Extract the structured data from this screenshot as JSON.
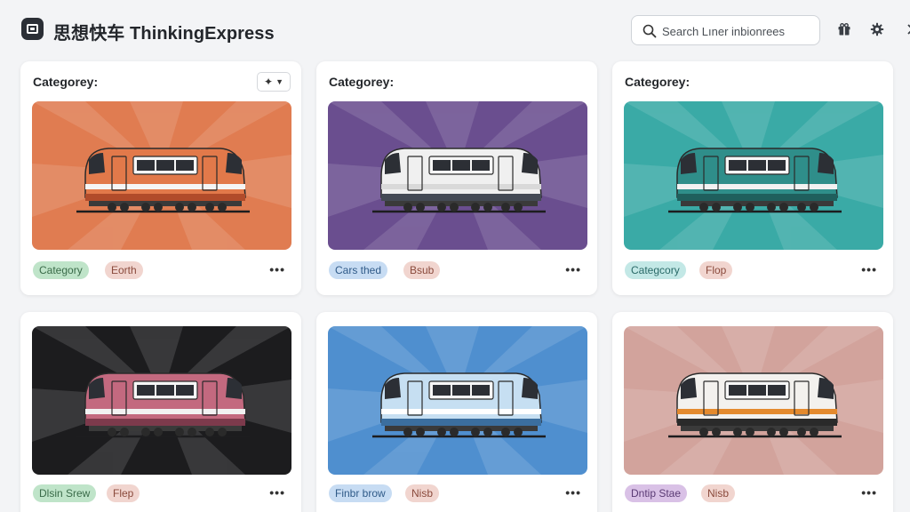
{
  "app": {
    "title": "思想快车 ThinkingExpress"
  },
  "search": {
    "placeholder": "Search Lıner inbionrees"
  },
  "header_icons": [
    "gift-icon",
    "gear-icon"
  ],
  "cards": [
    {
      "title": "Categorey:",
      "has_menu": true,
      "menu_icon": "sparkle-icon",
      "bg": "#e07c51",
      "body": "#e2794a",
      "stripe": "#f5f5f5",
      "accent": "#b14b2a",
      "tags": [
        {
          "label": "Category",
          "bg": "#bfe4c9",
          "color": "#3a6b49"
        },
        {
          "label": "Eorth",
          "bg": "#f1d5cf",
          "color": "#8a4a3c"
        }
      ]
    },
    {
      "title": "Categorey:",
      "has_menu": false,
      "bg": "#6a4e8f",
      "body": "#f0f0f0",
      "stripe": "#d9d9d9",
      "accent": "#444a55",
      "tags": [
        {
          "label": "Cars thed",
          "bg": "#c7dcf3",
          "color": "#2f5a88"
        },
        {
          "label": "Bsub",
          "bg": "#f1d5cf",
          "color": "#8a4a3c"
        }
      ]
    },
    {
      "title": "Categorey:",
      "has_menu": false,
      "bg": "#3aaaa6",
      "body": "#2f8e8a",
      "stripe": "#f2f2f2",
      "accent": "#1f5f5d",
      "tags": [
        {
          "label": "Categcory",
          "bg": "#c3e8e6",
          "color": "#2a6a68"
        },
        {
          "label": "Flop",
          "bg": "#f1d5cf",
          "color": "#8a4a3c"
        }
      ]
    },
    {
      "title": "",
      "has_menu": false,
      "bg": "#1c1c1e",
      "body": "#c3697f",
      "stripe": "#f2f2f2",
      "accent": "#7d3a4c",
      "tags": [
        {
          "label": "Dlsin Srew",
          "bg": "#bfe4c9",
          "color": "#3a6b49"
        },
        {
          "label": "Flep",
          "bg": "#f1d5cf",
          "color": "#8a4a3c"
        }
      ]
    },
    {
      "title": "",
      "has_menu": false,
      "bg": "#4f8fcf",
      "body": "#c6dff2",
      "stripe": "#ffffff",
      "accent": "#3b6e9e",
      "tags": [
        {
          "label": "Finbr brow",
          "bg": "#c7dcf3",
          "color": "#2f5a88"
        },
        {
          "label": "Nisb",
          "bg": "#f1d5cf",
          "color": "#8a4a3c"
        }
      ]
    },
    {
      "title": "",
      "has_menu": false,
      "bg": "#d2a39c",
      "body": "#f3f1ee",
      "stripe": "#e48a2e",
      "accent": "#2a2a2a",
      "tags": [
        {
          "label": "Dntip Stae",
          "bg": "#d9c1e6",
          "color": "#5a3a74"
        },
        {
          "label": "Nisb",
          "bg": "#f1d5cf",
          "color": "#8a4a3c"
        }
      ]
    }
  ]
}
